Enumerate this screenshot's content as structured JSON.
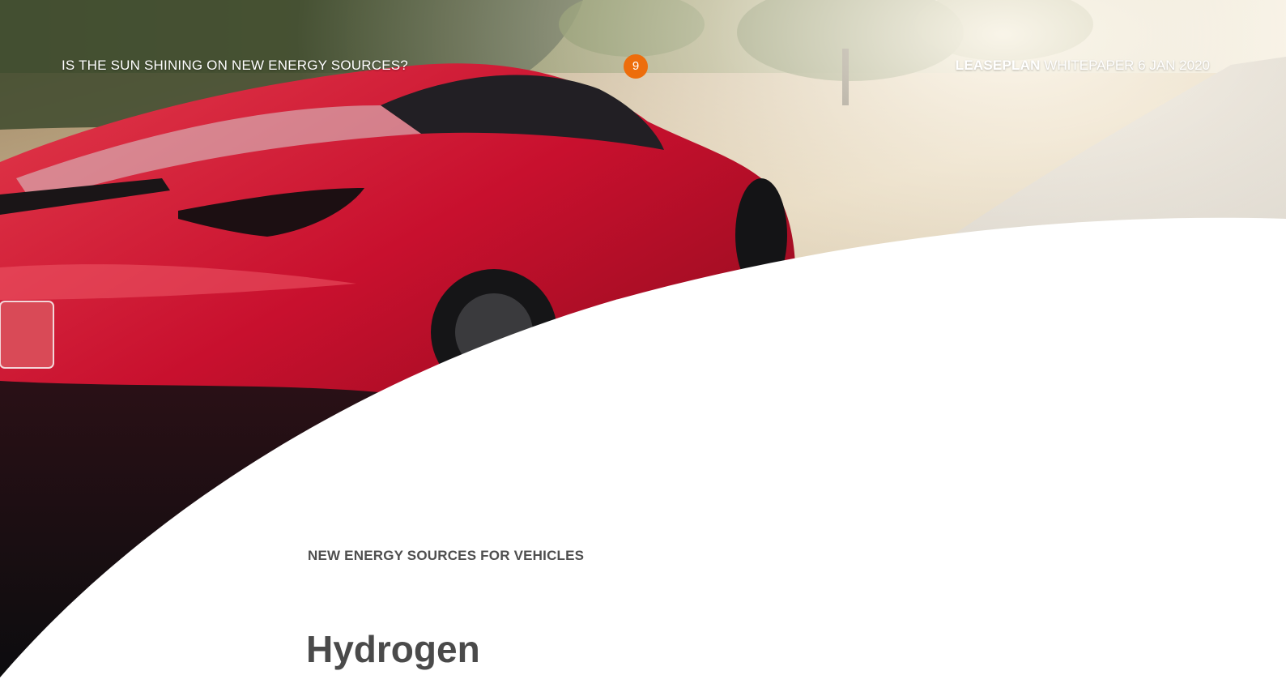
{
  "header": {
    "title": "IS THE SUN SHINING ON NEW ENERGY SOURCES?",
    "page_number": "9",
    "brand": "LEASEPLAN",
    "meta": "WHITEPAPER 6 JAN 2020"
  },
  "content": {
    "section_label": "NEW ENERGY SOURCES FOR VEHICLES",
    "heading": "Hydrogen"
  },
  "colors": {
    "accent": "#ed6d0c",
    "car_red": "#c8102e",
    "heading_text": "#4a4a4a"
  }
}
